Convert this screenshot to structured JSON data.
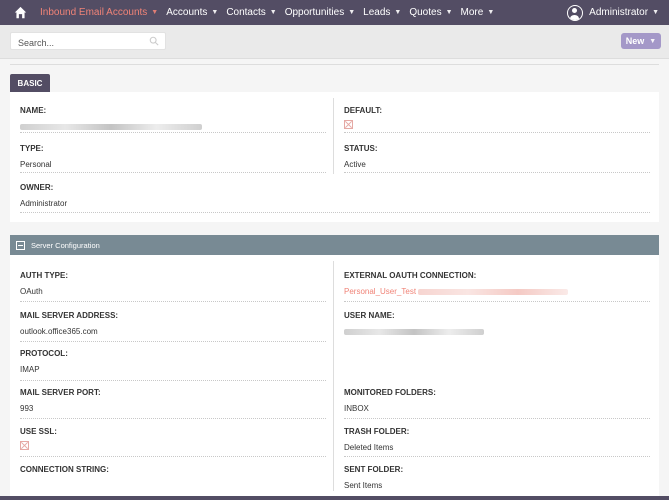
{
  "nav": {
    "items": [
      {
        "label": "Inbound Email Accounts",
        "active": true
      },
      {
        "label": "Accounts"
      },
      {
        "label": "Contacts"
      },
      {
        "label": "Opportunities"
      },
      {
        "label": "Leads"
      },
      {
        "label": "Quotes"
      },
      {
        "label": "More"
      }
    ],
    "user_label": "Administrator"
  },
  "search": {
    "placeholder": "Search..."
  },
  "new_button": {
    "label": "New"
  },
  "tabs": [
    {
      "label": "BASIC"
    }
  ],
  "basic": {
    "name_label": "NAME:",
    "default_label": "DEFAULT:",
    "type_label": "TYPE:",
    "type_value": "Personal",
    "status_label": "STATUS:",
    "status_value": "Active",
    "owner_label": "OWNER:",
    "owner_value": "Administrator"
  },
  "server": {
    "title": "Server Configuration",
    "auth_type_label": "AUTH TYPE:",
    "auth_type_value": "OAuth",
    "external_oauth_label": "EXTERNAL OAUTH CONNECTION:",
    "external_oauth_value": "Personal_User_Test",
    "mail_server_label": "MAIL SERVER ADDRESS:",
    "mail_server_value": "outlook.office365.com",
    "user_name_label": "USER NAME:",
    "protocol_label": "PROTOCOL:",
    "protocol_value": "IMAP",
    "port_label": "MAIL SERVER PORT:",
    "port_value": "993",
    "monitored_label": "MONITORED FOLDERS:",
    "monitored_value": "INBOX",
    "ssl_label": "USE SSL:",
    "trash_label": "TRASH FOLDER:",
    "trash_value": "Deleted Items",
    "conn_label": "CONNECTION STRING:",
    "sent_label": "SENT FOLDER:",
    "sent_value": "Sent Items"
  },
  "colors": {
    "nav_bg": "#534d64",
    "accent": "#f08377",
    "section_bg": "#788a94",
    "new_button": "#a498c8"
  }
}
